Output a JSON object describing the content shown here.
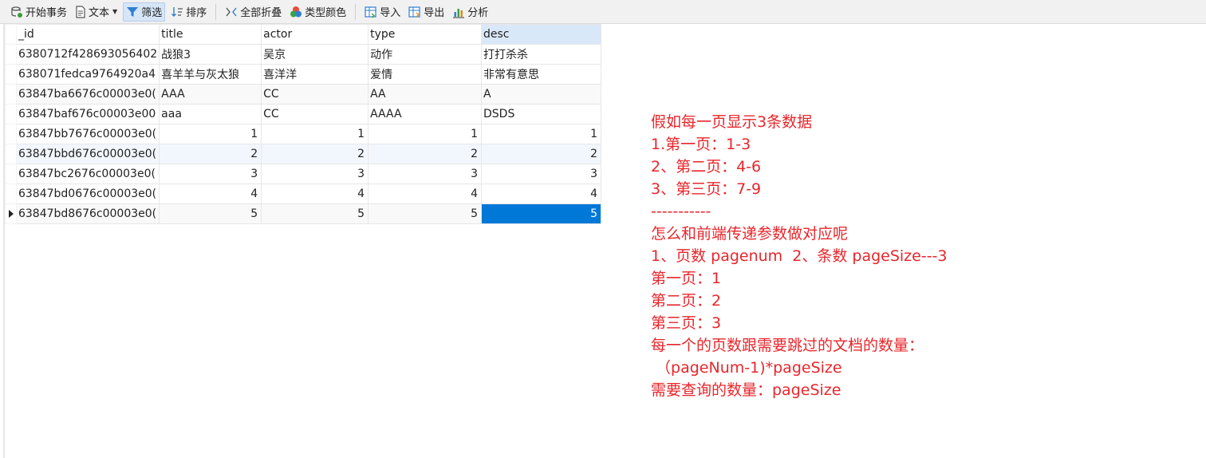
{
  "colors": {
    "accent": "#0078d7",
    "note_text": "#e8262b",
    "header_selected": "#d9e8f8"
  },
  "toolbar": {
    "items": [
      {
        "icon": "transaction-icon",
        "label": "开始事务"
      },
      {
        "icon": "text-icon",
        "label": "文本"
      },
      {
        "icon": "filter-icon",
        "label": "筛选"
      },
      {
        "icon": "sort-icon",
        "label": "排序"
      },
      {
        "icon": "collapse-all-icon",
        "label": "全部折叠"
      },
      {
        "icon": "type-color-icon",
        "label": "类型颜色"
      },
      {
        "icon": "import-icon",
        "label": "导入"
      },
      {
        "icon": "export-icon",
        "label": "导出"
      },
      {
        "icon": "analysis-icon",
        "label": "分析"
      }
    ]
  },
  "grid": {
    "columns": [
      "_id",
      "title",
      "actor",
      "type",
      "desc"
    ],
    "rows": [
      [
        "6380712f428693056402",
        "战狼3",
        "吴京",
        "动作",
        "打打杀杀"
      ],
      [
        "638071fedca9764920a4",
        "喜羊羊与灰太狼",
        "喜洋洋",
        "爱情",
        "非常有意思"
      ],
      [
        "63847ba6676c00003e0(",
        "AAA",
        "CC",
        "AA",
        "A"
      ],
      [
        "63847baf676c00003e00",
        "aaa",
        "CC",
        "AAAA",
        "DSDS"
      ],
      [
        "63847bb7676c00003e0(",
        "1",
        "1",
        "1",
        "1"
      ],
      [
        "63847bbd676c00003e0(",
        "2",
        "2",
        "2",
        "2"
      ],
      [
        "63847bc2676c00003e0(",
        "3",
        "3",
        "3",
        "3"
      ],
      [
        "63847bd0676c00003e0(",
        "4",
        "4",
        "4",
        "4"
      ],
      [
        "63847bd8676c00003e0(",
        "5",
        "5",
        "5",
        "5"
      ]
    ]
  },
  "notes": [
    "假如每一页显示3条数据",
    "1.第一页：1-3",
    "2、第二页：4-6",
    "3、第三页：7-9",
    "-----------",
    "怎么和前端传递参数做对应呢",
    "1、页数 pagenum  2、条数 pageSize---3",
    "第一页：1",
    "第二页：2",
    "第三页：3",
    "每一个的页数跟需要跳过的文档的数量：",
    " （pageNum-1)*pageSize",
    "需要查询的数量：pageSize"
  ]
}
